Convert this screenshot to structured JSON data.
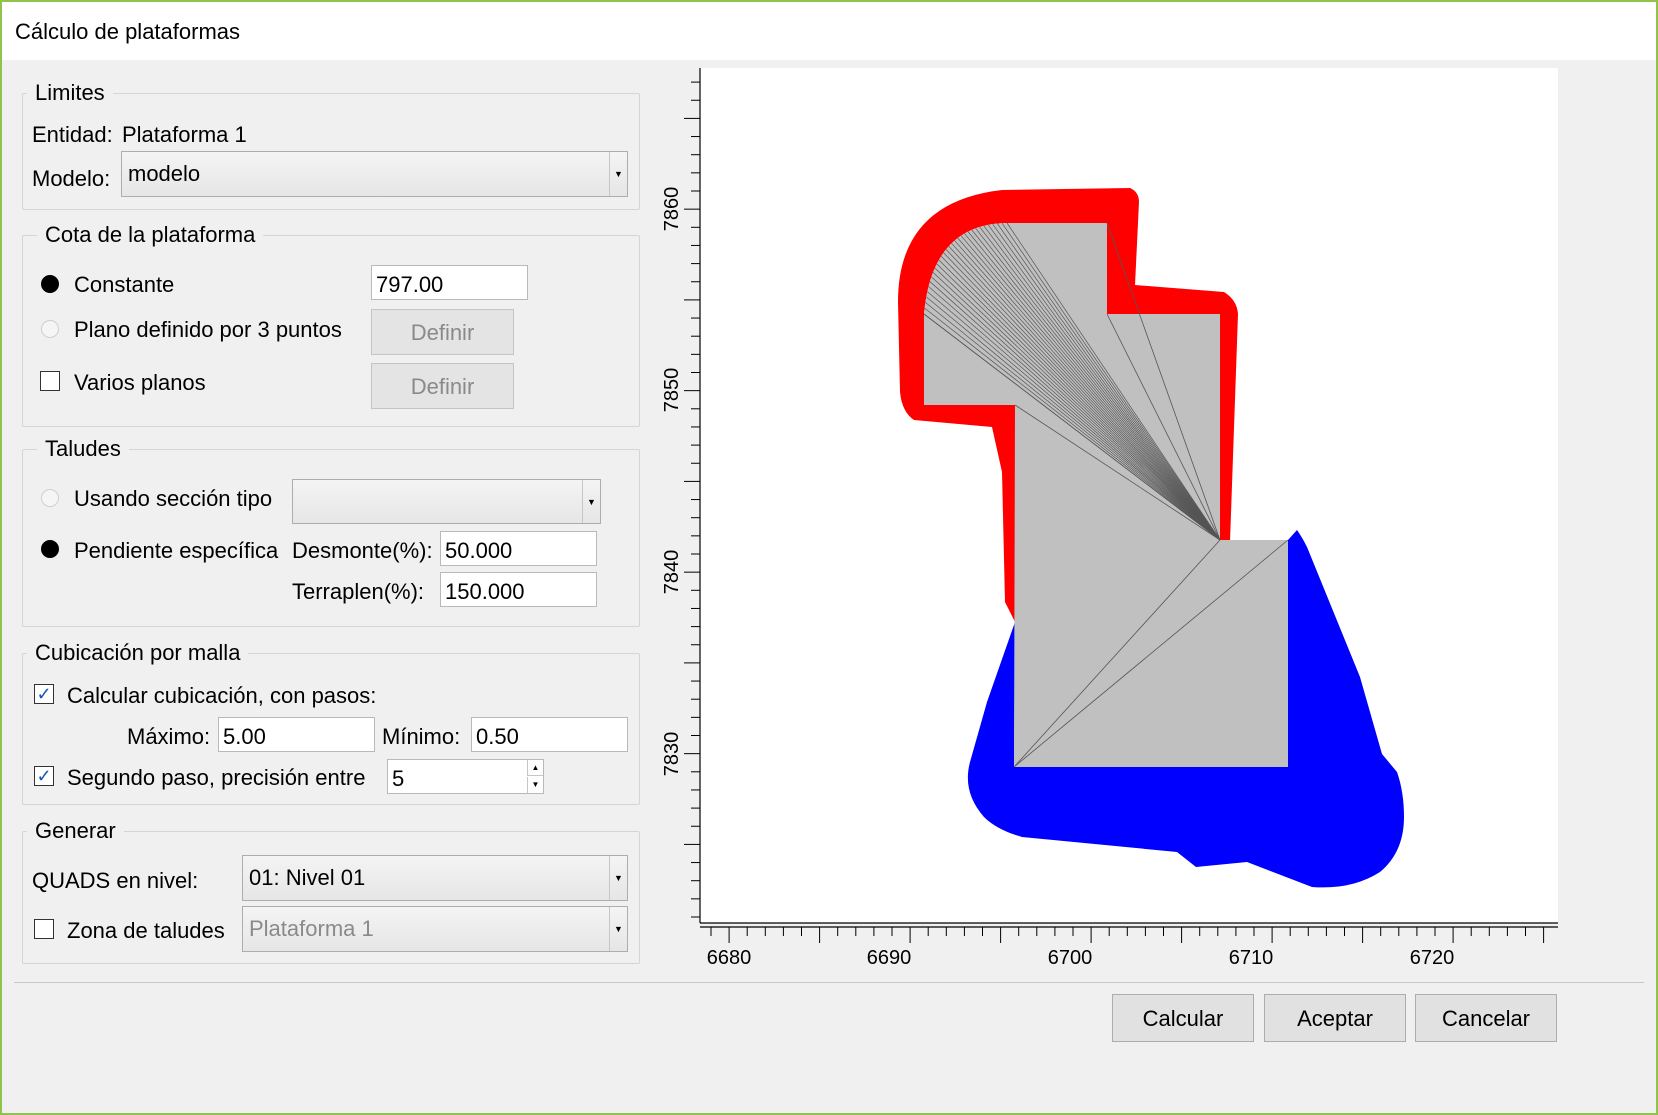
{
  "window": {
    "title": "Cálculo de plataformas"
  },
  "limites": {
    "legend": "Limites",
    "entidad_label": "Entidad:",
    "entidad_value": "Plataforma 1",
    "modelo_label": "Modelo:",
    "modelo_value": "modelo"
  },
  "cota": {
    "legend": "Cota de la plataforma",
    "constante_label": "Constante",
    "constante_value": "797.00",
    "constante_selected": true,
    "plano_label": "Plano definido por 3 puntos",
    "definir1_label": "Definir",
    "varios_label": "Varios planos",
    "varios_checked": false,
    "definir2_label": "Definir"
  },
  "taludes": {
    "legend": "Taludes",
    "seccion_label": "Usando sección tipo",
    "seccion_value": "",
    "pendiente_label": "Pendiente específica",
    "pendiente_selected": true,
    "desmonte_label": "Desmonte(%):",
    "desmonte_value": "50.000",
    "terraplen_label": "Terraplen(%):",
    "terraplen_value": "150.000"
  },
  "cubicacion": {
    "legend": "Cubicación por malla",
    "calcular_label": "Calcular cubicación, con pasos:",
    "calcular_checked": true,
    "maximo_label": "Máximo:",
    "maximo_value": "5.00",
    "minimo_label": "Mínimo:",
    "minimo_value": "0.50",
    "segundo_label": "Segundo paso, precisión entre",
    "segundo_checked": true,
    "precision_value": "5"
  },
  "generar": {
    "legend": "Generar",
    "quads_label": "QUADS en nivel:",
    "quads_value": "01: Nivel 01",
    "zona_label": "Zona de taludes",
    "zona_checked": false,
    "zona_value": "Plataforma 1"
  },
  "buttons": {
    "calcular": "Calcular",
    "aceptar": "Aceptar",
    "cancelar": "Cancelar"
  },
  "chart": {
    "x_ticks": [
      "6680",
      "6690",
      "6700",
      "6710",
      "6720"
    ],
    "y_ticks": [
      "7830",
      "7840",
      "7850",
      "7860"
    ],
    "xlim": [
      6679.5,
      6726.5
    ],
    "ylim": [
      7821.5,
      7866.5
    ],
    "colors": {
      "cut_zone": "#ff0000",
      "fill_zone": "#0000ff",
      "platform": "#c0c0c0",
      "mesh_lines": "#555555"
    }
  }
}
